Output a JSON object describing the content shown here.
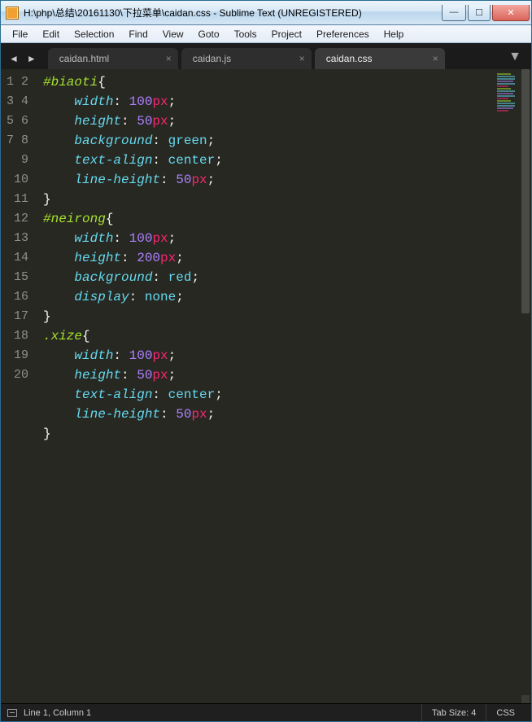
{
  "window": {
    "title": "H:\\php\\总结\\20161130\\下拉菜单\\caidan.css - Sublime Text (UNREGISTERED)"
  },
  "menu": {
    "items": [
      "File",
      "Edit",
      "Selection",
      "Find",
      "View",
      "Goto",
      "Tools",
      "Project",
      "Preferences",
      "Help"
    ]
  },
  "tabs": {
    "items": [
      {
        "label": "caidan.html",
        "active": false
      },
      {
        "label": "caidan.js",
        "active": false
      },
      {
        "label": "caidan.css",
        "active": true
      }
    ]
  },
  "editor": {
    "line_numbers": [
      "1",
      "2",
      "3",
      "4",
      "5",
      "6",
      "7",
      "8",
      "9",
      "10",
      "11",
      "12",
      "13",
      "14",
      "15",
      "16",
      "17",
      "18",
      "19",
      "20"
    ],
    "code": [
      {
        "indent": 0,
        "tokens": [
          {
            "t": "#biaoti",
            "c": "sel"
          },
          {
            "t": "{",
            "c": "br"
          }
        ]
      },
      {
        "indent": 1,
        "tokens": [
          {
            "t": "width",
            "c": "prop"
          },
          {
            "t": ": ",
            "c": "br"
          },
          {
            "t": "100",
            "c": "num"
          },
          {
            "t": "px",
            "c": "unit"
          },
          {
            "t": ";",
            "c": "br"
          }
        ]
      },
      {
        "indent": 1,
        "tokens": [
          {
            "t": "height",
            "c": "prop"
          },
          {
            "t": ": ",
            "c": "br"
          },
          {
            "t": "50",
            "c": "num"
          },
          {
            "t": "px",
            "c": "unit"
          },
          {
            "t": ";",
            "c": "br"
          }
        ]
      },
      {
        "indent": 1,
        "tokens": [
          {
            "t": "background",
            "c": "prop"
          },
          {
            "t": ": ",
            "c": "br"
          },
          {
            "t": "green",
            "c": "cons"
          },
          {
            "t": ";",
            "c": "br"
          }
        ]
      },
      {
        "indent": 1,
        "tokens": [
          {
            "t": "text-align",
            "c": "prop"
          },
          {
            "t": ": ",
            "c": "br"
          },
          {
            "t": "center",
            "c": "cons"
          },
          {
            "t": ";",
            "c": "br"
          }
        ]
      },
      {
        "indent": 1,
        "tokens": [
          {
            "t": "line-height",
            "c": "prop"
          },
          {
            "t": ": ",
            "c": "br"
          },
          {
            "t": "50",
            "c": "num"
          },
          {
            "t": "px",
            "c": "unit"
          },
          {
            "t": ";",
            "c": "br"
          }
        ]
      },
      {
        "indent": 0,
        "tokens": [
          {
            "t": "}",
            "c": "br"
          }
        ]
      },
      {
        "indent": 0,
        "tokens": [
          {
            "t": "#neirong",
            "c": "sel"
          },
          {
            "t": "{",
            "c": "br"
          }
        ]
      },
      {
        "indent": 1,
        "tokens": [
          {
            "t": "width",
            "c": "prop"
          },
          {
            "t": ": ",
            "c": "br"
          },
          {
            "t": "100",
            "c": "num"
          },
          {
            "t": "px",
            "c": "unit"
          },
          {
            "t": ";",
            "c": "br"
          }
        ]
      },
      {
        "indent": 1,
        "tokens": [
          {
            "t": "height",
            "c": "prop"
          },
          {
            "t": ": ",
            "c": "br"
          },
          {
            "t": "200",
            "c": "num"
          },
          {
            "t": "px",
            "c": "unit"
          },
          {
            "t": ";",
            "c": "br"
          }
        ]
      },
      {
        "indent": 1,
        "tokens": [
          {
            "t": "background",
            "c": "prop"
          },
          {
            "t": ": ",
            "c": "br"
          },
          {
            "t": "red",
            "c": "cons"
          },
          {
            "t": ";",
            "c": "br"
          }
        ]
      },
      {
        "indent": 1,
        "tokens": [
          {
            "t": "display",
            "c": "prop"
          },
          {
            "t": ": ",
            "c": "br"
          },
          {
            "t": "none",
            "c": "cons"
          },
          {
            "t": ";",
            "c": "br"
          }
        ]
      },
      {
        "indent": 0,
        "tokens": [
          {
            "t": "}",
            "c": "br"
          }
        ]
      },
      {
        "indent": 0,
        "tokens": [
          {
            "t": ".xize",
            "c": "sel"
          },
          {
            "t": "{",
            "c": "br"
          }
        ]
      },
      {
        "indent": 1,
        "tokens": [
          {
            "t": "width",
            "c": "prop"
          },
          {
            "t": ": ",
            "c": "br"
          },
          {
            "t": "100",
            "c": "num"
          },
          {
            "t": "px",
            "c": "unit"
          },
          {
            "t": ";",
            "c": "br"
          }
        ]
      },
      {
        "indent": 1,
        "tokens": [
          {
            "t": "height",
            "c": "prop"
          },
          {
            "t": ": ",
            "c": "br"
          },
          {
            "t": "50",
            "c": "num"
          },
          {
            "t": "px",
            "c": "unit"
          },
          {
            "t": ";",
            "c": "br"
          }
        ]
      },
      {
        "indent": 1,
        "tokens": [
          {
            "t": "text-align",
            "c": "prop"
          },
          {
            "t": ": ",
            "c": "br"
          },
          {
            "t": "center",
            "c": "cons"
          },
          {
            "t": ";",
            "c": "br"
          }
        ]
      },
      {
        "indent": 1,
        "tokens": [
          {
            "t": "line-height",
            "c": "prop"
          },
          {
            "t": ": ",
            "c": "br"
          },
          {
            "t": "50",
            "c": "num"
          },
          {
            "t": "px",
            "c": "unit"
          },
          {
            "t": ";",
            "c": "br"
          }
        ]
      },
      {
        "indent": 0,
        "tokens": [
          {
            "t": "}",
            "c": "br"
          }
        ]
      },
      {
        "indent": 0,
        "tokens": []
      }
    ]
  },
  "status": {
    "position": "Line 1, Column 1",
    "tabsize": "Tab Size: 4",
    "syntax": "CSS"
  },
  "glyphs": {
    "nav_left": "◄",
    "nav_right": "►",
    "close": "×",
    "hamburger": "▼",
    "min": "—",
    "max": "☐",
    "winclose": "✕"
  }
}
